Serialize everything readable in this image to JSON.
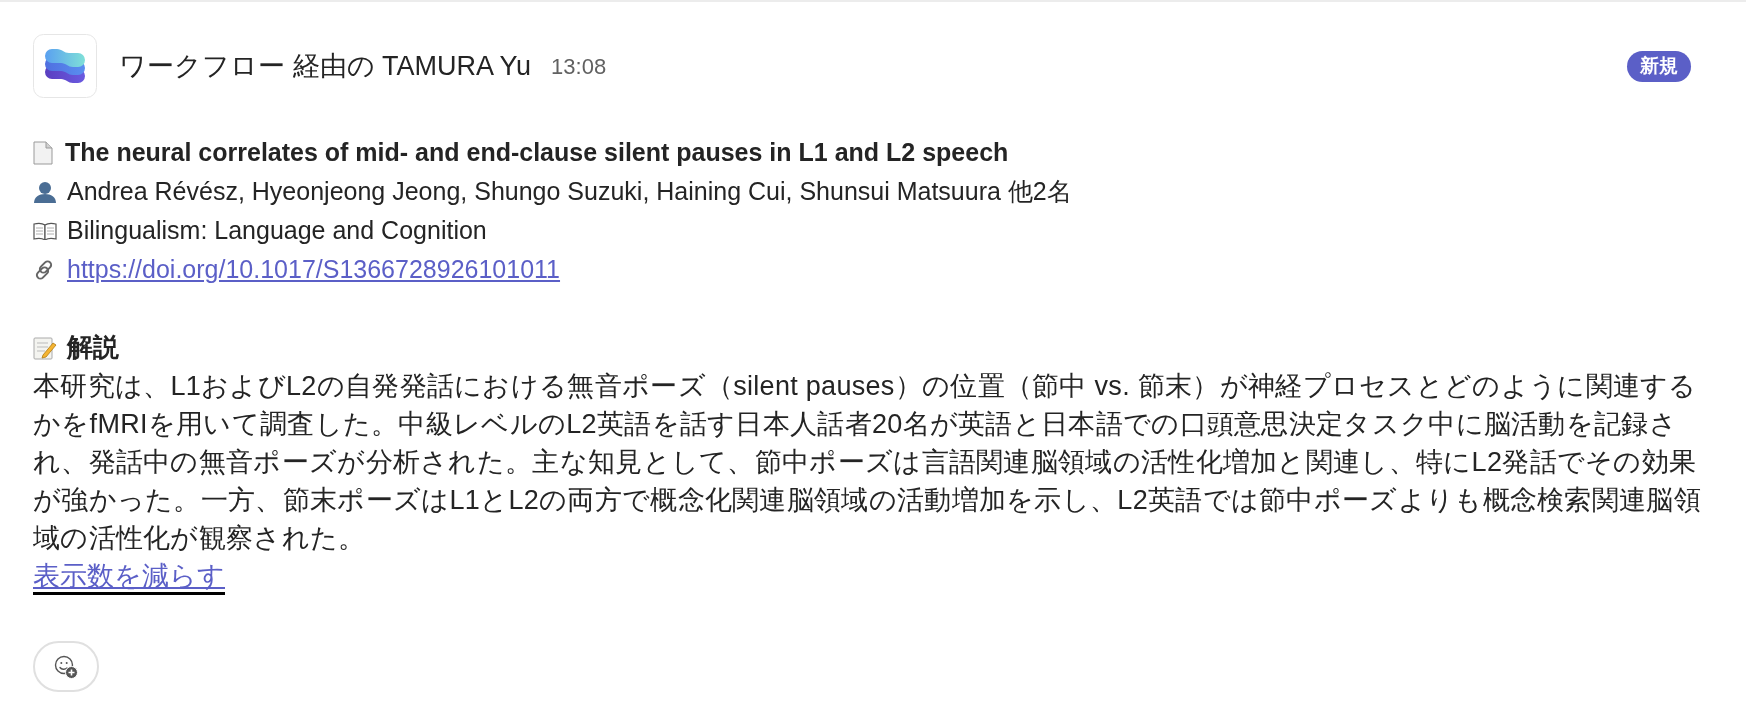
{
  "message": {
    "sender": "ワークフロー 経由の TAMURA Yu",
    "time": "13:08",
    "badge": "新規"
  },
  "paper": {
    "title": "The neural correlates of mid- and end-clause silent pauses in L1 and L2 speech",
    "authors": "Andrea Révész, Hyeonjeong Jeong, Shungo Suzuki, Haining Cui, Shunsui Matsuura 他2名",
    "journal": "Bilingualism: Language and Cognition",
    "url": "https://doi.org/10.1017/S1366728926101011"
  },
  "summary": {
    "heading": "解説",
    "body": "本研究は、L1およびL2の自発発話における無音ポーズ（silent pauses）の位置（節中 vs. 節末）が神経プロセスとどのように関連するかをfMRIを用いて調査した。中級レベルのL2英語を話す日本人話者20名が英語と日本語での口頭意思決定タスク中に脳活動を記録され、発話中の無音ポーズが分析された。主な知見として、節中ポーズは言語関連脳領域の活性化増加と関連し、特にL2発話でその効果が強かった。一方、節末ポーズはL1とL2の両方で概念化関連脳領域の活動増加を示し、L2英語では節中ポーズよりも概念検索関連脳領域の活性化が観察された。",
    "toggle": "表示数を減らす"
  }
}
